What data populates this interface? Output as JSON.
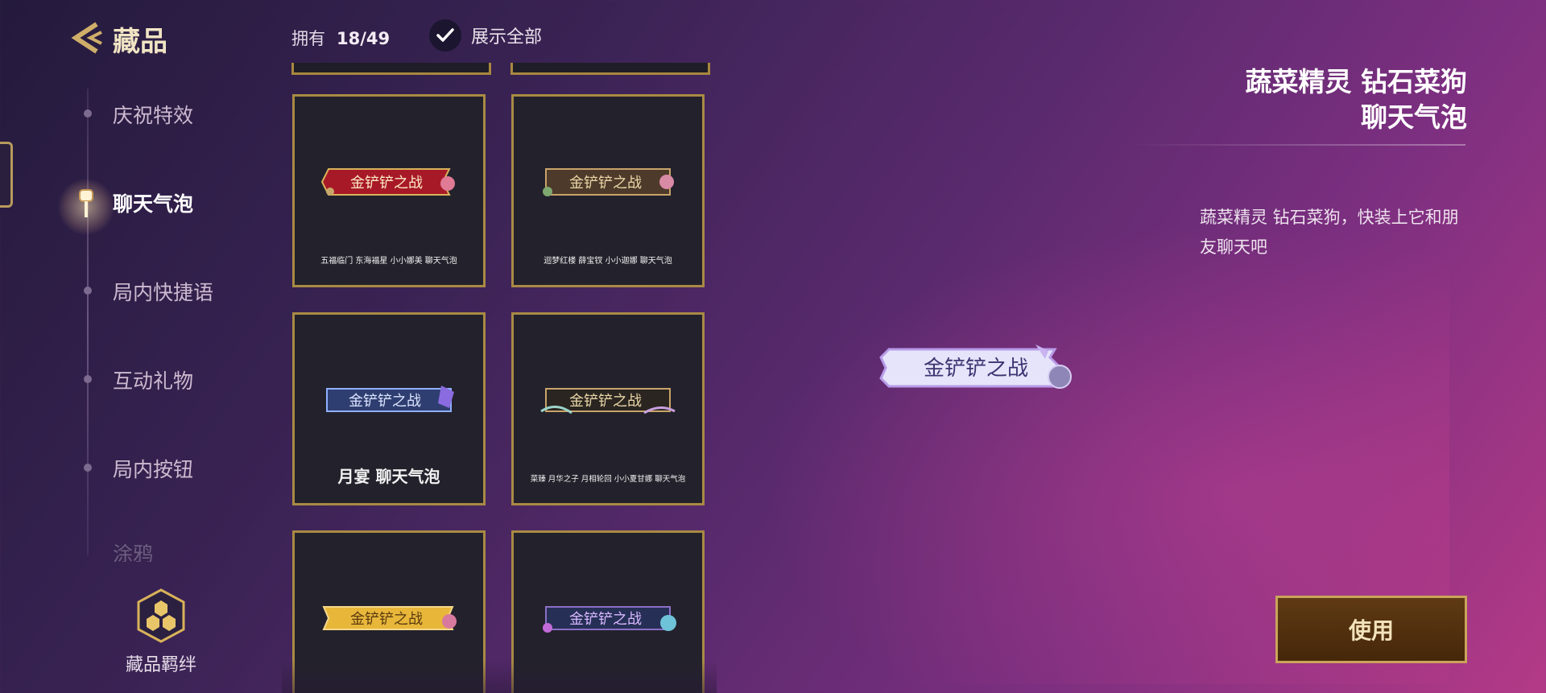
{
  "header": {
    "title": "藏品",
    "owned_label": "拥有",
    "owned_count": "18/49",
    "show_all_label": "展示全部",
    "show_all_checked": true
  },
  "nav": {
    "items": [
      {
        "label": "庆祝特效",
        "active": false
      },
      {
        "label": "聊天气泡",
        "active": true
      },
      {
        "label": "局内快捷语",
        "active": false
      },
      {
        "label": "互动礼物",
        "active": false
      },
      {
        "label": "局内按钮",
        "active": false
      },
      {
        "label": "涂鸦",
        "active": false
      }
    ],
    "collection_bond_label": "藏品羁绊"
  },
  "cards": [
    {
      "bubble_text": "金铲铲之战",
      "name": "五福临门  东海福星  小小娜美   聊天气泡",
      "theme": "red",
      "bubble_bg": "#a81927",
      "bubble_fg": "#fbe9c5"
    },
    {
      "bubble_text": "金铲铲之战",
      "name": "迴梦红楼  薛宝钗  小小迦娜  聊天气泡",
      "theme": "brown",
      "bubble_bg": "#4e3a2a",
      "bubble_fg": "#ead6a6"
    },
    {
      "bubble_text": "金铲铲之战",
      "name": "月宴  聊天气泡",
      "theme": "blue",
      "bubble_bg": "#2f3e70",
      "bubble_fg": "#dbe4ff"
    },
    {
      "bubble_text": "金铲铲之战",
      "name": "菜臻  月华之子  月相轮回  小小夏甘娜  聊天气泡",
      "theme": "dark",
      "bubble_bg": "#2a2520",
      "bubble_fg": "#e9d6a8"
    },
    {
      "bubble_text": "金铲铲之战",
      "theme": "yellow",
      "bubble_bg": "#e8b73a",
      "bubble_fg": "#5a3a10"
    },
    {
      "bubble_text": "金铲铲之战",
      "theme": "navy",
      "bubble_bg": "#262f55",
      "bubble_fg": "#d7b7ff"
    }
  ],
  "detail": {
    "title_line1": "蔬菜精灵  钻石菜狗",
    "title_line2": "聊天气泡",
    "description": "蔬菜精灵 钻石菜狗，快装上它和朋友聊天吧",
    "preview_text": "金铲铲之战",
    "use_button": "使用"
  },
  "colors": {
    "gold_border": "#a98a44",
    "card_bg": "#23222c",
    "accent_gold": "#f0e4c4"
  }
}
